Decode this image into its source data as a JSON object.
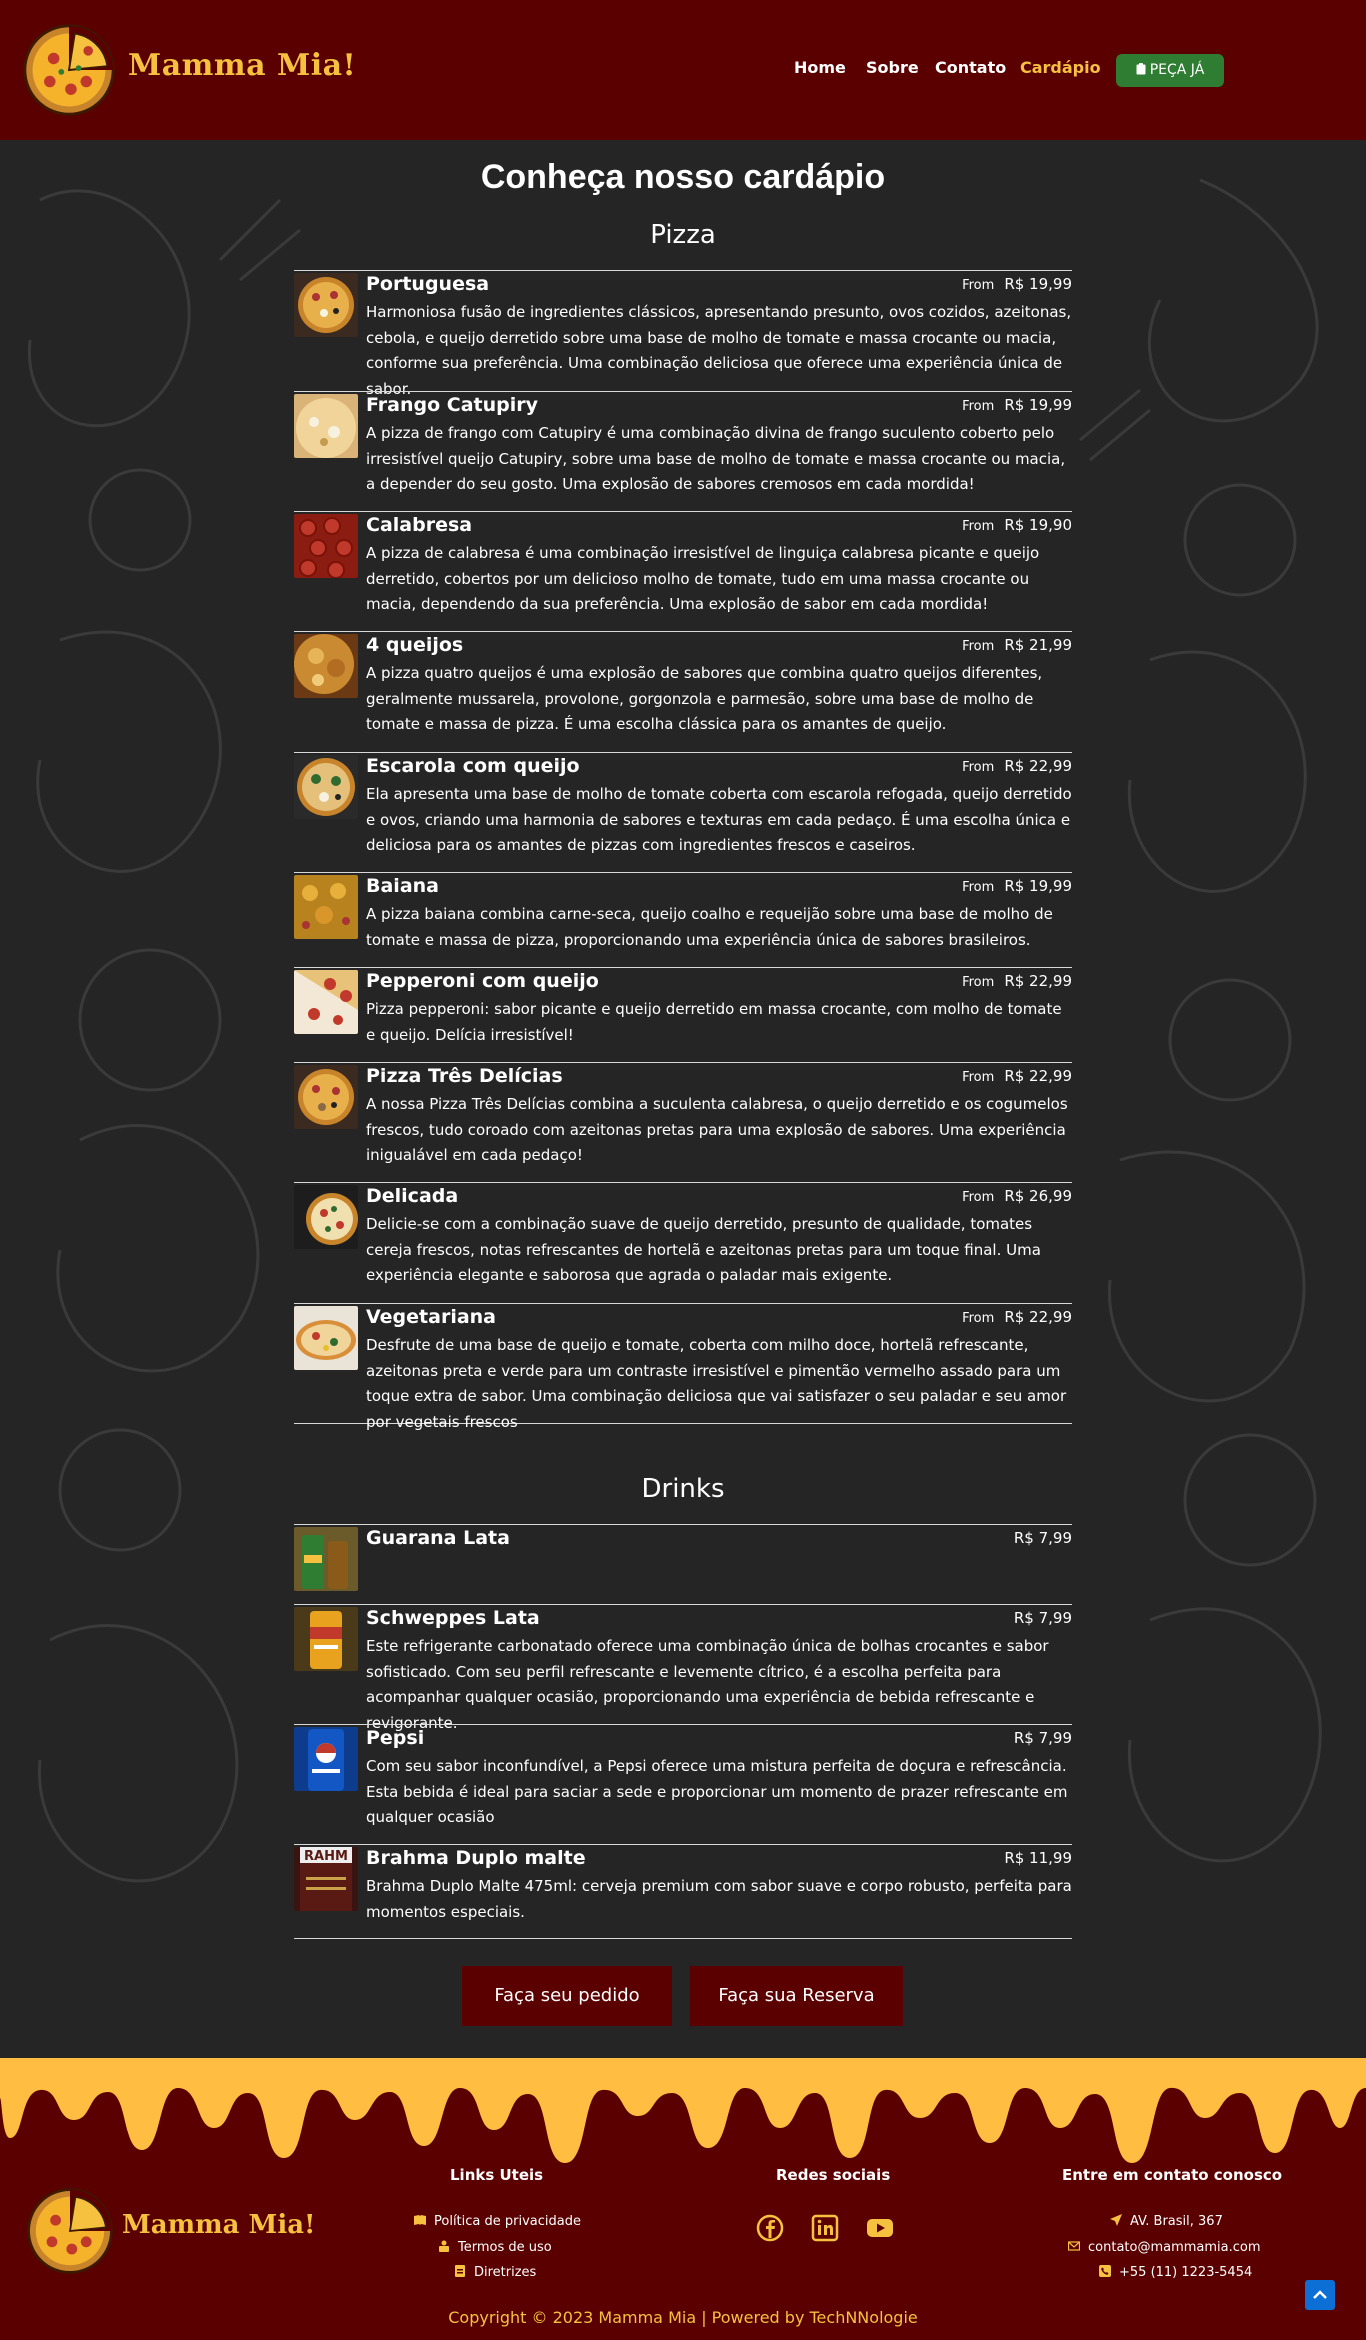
{
  "header": {
    "brand": "Mamma Mia!",
    "nav": [
      "Home",
      "Sobre",
      "Contato",
      "Cardápio"
    ],
    "active_nav": "Cardápio",
    "order_button": "PEÇA JÁ",
    "accent_color": "#f6c13f",
    "bg_color": "#5a0000"
  },
  "page_title": "Conheça nosso cardápio",
  "pizza_section": {
    "title": "Pizza",
    "from_label": "From",
    "items": [
      {
        "name": "Portuguesa",
        "price": "R$ 19,99",
        "desc": "Harmoniosa fusão de ingredientes clássicos, apresentando presunto, ovos cozidos, azeitonas, cebola, e queijo derretido sobre uma base de molho de tomate e massa crocante ou macia, conforme sua preferência. Uma combinação deliciosa que oferece uma experiência única de sabor."
      },
      {
        "name": "Frango Catupiry",
        "price": "R$ 19,99",
        "desc": "A pizza de frango com Catupiry é uma combinação divina de frango suculento coberto pelo irresistível queijo Catupiry, sobre uma base de molho de tomate e massa crocante ou macia, a depender do seu gosto. Uma explosão de sabores cremosos em cada mordida!"
      },
      {
        "name": "Calabresa",
        "price": "R$ 19,90",
        "desc": "A pizza de calabresa é uma combinação irresistível de linguiça calabresa picante e queijo derretido, cobertos por um delicioso molho de tomate, tudo em uma massa crocante ou macia, dependendo da sua preferência. Uma explosão de sabor em cada mordida!"
      },
      {
        "name": "4 queijos",
        "price": "R$ 21,99",
        "desc": "A pizza quatro queijos é uma explosão de sabores que combina quatro queijos diferentes, geralmente mussarela, provolone, gorgonzola e parmesão, sobre uma base de molho de tomate e massa de pizza. É uma escolha clássica para os amantes de queijo."
      },
      {
        "name": "Escarola com queijo",
        "price": "R$ 22,99",
        "desc": "Ela apresenta uma base de molho de tomate coberta com escarola refogada, queijo derretido e ovos, criando uma harmonia de sabores e texturas em cada pedaço. É uma escolha única e deliciosa para os amantes de pizzas com ingredientes frescos e caseiros."
      },
      {
        "name": "Baiana",
        "price": "R$ 19,99",
        "desc": "A pizza baiana combina carne-seca, queijo coalho e requeijão sobre uma base de molho de tomate e massa de pizza, proporcionando uma experiência única de sabores brasileiros."
      },
      {
        "name": "Pepperoni com queijo",
        "price": "R$ 22,99",
        "desc": "Pizza pepperoni: sabor picante e queijo derretido em massa crocante, com molho de tomate e queijo. Delícia irresistível!"
      },
      {
        "name": "Pizza Três Delícias",
        "price": "R$ 22,99",
        "desc": "A nossa Pizza Três Delícias combina a suculenta calabresa, o queijo derretido e os cogumelos frescos, tudo coroado com azeitonas pretas para uma explosão de sabores. Uma experiência inigualável em cada pedaço!"
      },
      {
        "name": "Delicada",
        "price": "R$ 26,99",
        "desc": "Delicie-se com a combinação suave de queijo derretido, presunto de qualidade, tomates cereja frescos, notas refrescantes de hortelã e azeitonas pretas para um toque final. Uma experiência elegante e saborosa que agrada o paladar mais exigente."
      },
      {
        "name": "Vegetariana",
        "price": "R$ 22,99",
        "desc": "Desfrute de uma base de queijo e tomate, coberta com milho doce, hortelã refrescante, azeitonas preta e verde para um contraste irresistível e pimentão vermelho assado para um toque extra de sabor. Uma combinação deliciosa que vai satisfazer o seu paladar e seu amor por vegetais frescos"
      }
    ]
  },
  "drinks_section": {
    "title": "Drinks",
    "items": [
      {
        "name": "Guarana Lata",
        "price": "R$ 7,99",
        "desc": ""
      },
      {
        "name": "Schweppes Lata",
        "price": "R$ 7,99",
        "desc": "Este refrigerante carbonatado oferece uma combinação única de bolhas crocantes e sabor sofisticado. Com seu perfil refrescante e levemente cítrico, é a escolha perfeita para acompanhar qualquer ocasião, proporcionando uma experiência de bebida refrescante e revigorante."
      },
      {
        "name": "Pepsi",
        "price": "R$ 7,99",
        "desc": "Com seu sabor inconfundível, a Pepsi oferece uma mistura perfeita de doçura e refrescância. Esta bebida é ideal para saciar a sede e proporcionar um momento de prazer refrescante em qualquer ocasião"
      },
      {
        "name": "Brahma Duplo malte",
        "price": "R$ 11,99",
        "desc": "Brahma Duplo Malte 475ml: cerveja premium com sabor suave e corpo robusto, perfeita para momentos especiais."
      }
    ],
    "brahma_can_text": "RAHM"
  },
  "cta": {
    "order": "Faça seu pedido",
    "reserve": "Faça sua Reserva"
  },
  "footer": {
    "brand": "Mamma Mia!",
    "links_title": "Links Uteis",
    "links": [
      "Política de privacidade",
      "Termos de uso",
      "Diretrizes"
    ],
    "social_title": "Redes sociais",
    "social_icons": [
      "facebook-icon",
      "linkedin-icon",
      "youtube-icon"
    ],
    "contact_title": "Entre em contato conosco",
    "contacts": [
      "AV. Brasil, 367",
      "contato@mammamia.com",
      "+55 (11) 1223-5454"
    ],
    "copyright": "Copyright © 2023 Mamma Mia | Powered by TechNNologie",
    "drip_color": "#ffbd42"
  }
}
